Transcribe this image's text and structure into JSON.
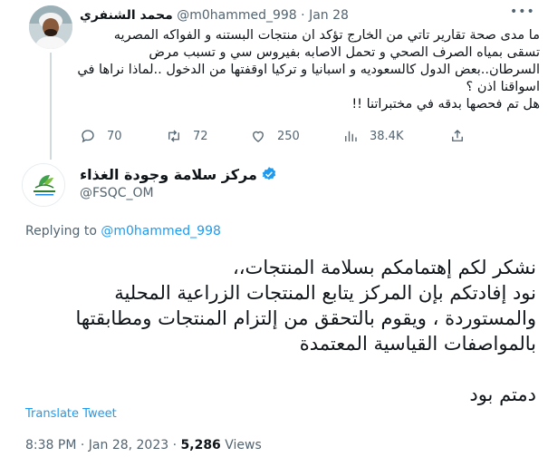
{
  "original_tweet": {
    "author_name": "محمد الشنفري",
    "handle": "@m0hammed_998",
    "separator": "·",
    "date": "Jan 28",
    "more_label": "•••",
    "text_lines": [
      "ما مدى صحة  تقارير تاتي من الخارج تؤكد ان منتجات البستنه و الفواكه المصريه",
      "تسقى بمياه الصرف الصحي و تحمل الاصابه بفيروس سي و تسبب مرض",
      "السرطان..بعض الدول كالسعوديه و اسبانيا و تركيا اوقفتها من الدخول ..لماذا نراها في",
      "اسواقنا اذن ؟",
      "هل تم فحصها بدقه في مختبراتنا !!"
    ],
    "stats": {
      "replies": "70",
      "retweets": "72",
      "likes": "250",
      "views": "38.4K"
    },
    "icons": [
      "reply-icon",
      "retweet-icon",
      "like-icon",
      "views-icon",
      "share-icon"
    ]
  },
  "reply_tweet": {
    "author_name": "مركز سلامة وجودة الغذاء",
    "handle": "@FSQC_OM",
    "verified": true,
    "replying_to_label": "Replying to",
    "replying_to_handle": "@m0hammed_998",
    "text_lines": [
      "نشكر لكم إهتمامكم بسلامة المنتجات،،",
      "نود إفادتكم بإن المركز يتابع المنتجات الزراعية المحلية",
      "والمستوردة ، ويقوم بالتحقق من إلتزام المنتجات ومطابقتها",
      "بالمواصفات القياسية المعتمدة"
    ],
    "signoff": "دمتم بود",
    "translate_label": "Translate Tweet",
    "time": "8:38 PM",
    "separator": "·",
    "date": "Jan 28, 2023",
    "views_count": "5,286",
    "views_label": "Views"
  },
  "colors": {
    "accent": "#1d9bf0",
    "text_primary": "#0f1419",
    "text_secondary": "#536471",
    "thread_line": "#cfd9de",
    "verified_badge": "#1d9bf0"
  }
}
